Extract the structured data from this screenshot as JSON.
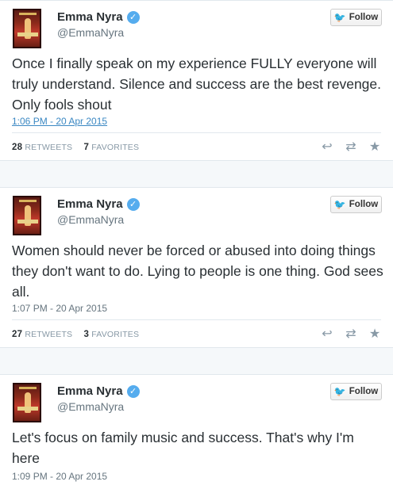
{
  "tweets": [
    {
      "name": "Emma Nyra",
      "handle": "@EmmaNyra",
      "follow_label": "Follow",
      "text": "Once I finally speak on my experience FULLY everyone will truly understand. Silence and success are the best revenge. Only fools shout",
      "timestamp": "1:06 PM - 20 Apr 2015",
      "retweets": "28",
      "retweets_label": "RETWEETS",
      "favorites": "7",
      "favorites_label": "FAVORITES"
    },
    {
      "name": "Emma Nyra",
      "handle": "@EmmaNyra",
      "follow_label": "Follow",
      "text": "Women should never be forced or abused into doing things they don't want to do. Lying to people is one thing. God sees all.",
      "timestamp": "1:07 PM - 20 Apr 2015",
      "retweets": "27",
      "retweets_label": "RETWEETS",
      "favorites": "3",
      "favorites_label": "FAVORITES"
    },
    {
      "name": "Emma Nyra",
      "handle": "@EmmaNyra",
      "follow_label": "Follow",
      "text": "Let's focus on family music and success. That's why I'm here",
      "timestamp": "1:09 PM - 20 Apr 2015"
    }
  ],
  "icons": {
    "verified": "verified-badge-icon",
    "follow": "twitter-bird-icon",
    "reply": "reply-icon",
    "retweet": "retweet-icon",
    "favorite": "star-icon"
  },
  "colors": {
    "accent": "#55acee",
    "link": "#3b88c3",
    "muted": "#8899a6",
    "text": "#292f33"
  }
}
